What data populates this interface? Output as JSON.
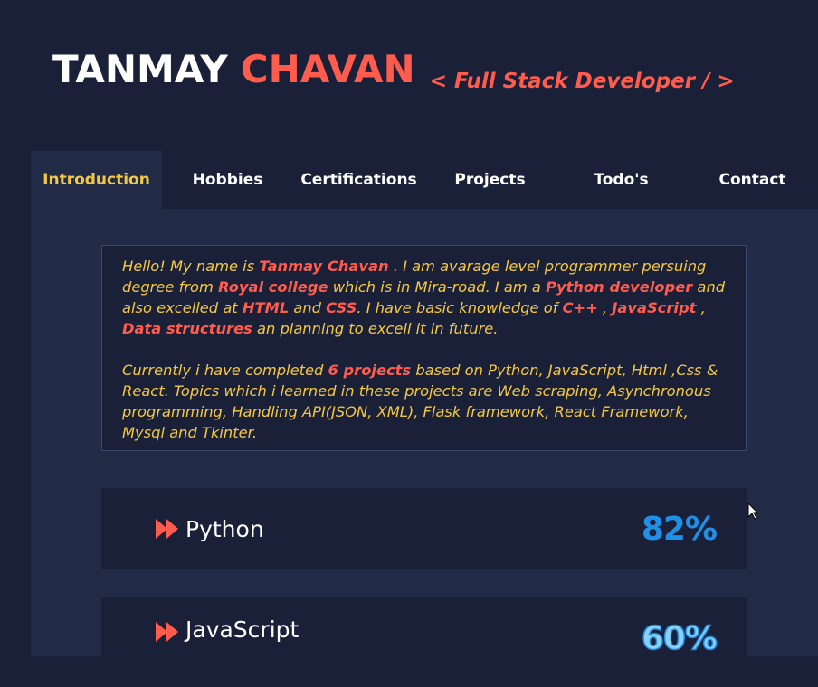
{
  "header": {
    "first_name": "TANMAY",
    "last_name": "CHAVAN",
    "role": "< Full Stack Developer / >"
  },
  "tabs": [
    {
      "label": "Introduction",
      "active": true
    },
    {
      "label": "Hobbies"
    },
    {
      "label": "Certifications"
    },
    {
      "label": "Projects"
    },
    {
      "label": "Todo's"
    },
    {
      "label": "Contact"
    }
  ],
  "intro": {
    "p1": [
      "Hello! My name is ",
      "Tanmay Chavan",
      " . I am avarage level programmer persuing degree from ",
      "Royal college",
      " which is in Mira-road. I am a ",
      "Python developer",
      " and also excelled at ",
      "HTML",
      " and ",
      "CSS",
      ". I have basic knowledge of ",
      "C++",
      " , ",
      "JavaScript",
      " , ",
      "Data structures",
      " an planning to excell it in future."
    ],
    "p2": [
      "Currently i have completed ",
      "6 projects",
      " based on Python, JavaScript, Html ,Css & React. Topics which i learned in these projects are Web scraping, Asynchronous programming, Handling API(JSON, XML), Flask framework, React Framework, Mysql and Tkinter."
    ]
  },
  "skills": [
    {
      "name": "Python",
      "percent": "82%"
    },
    {
      "name": "JavaScript",
      "percent": "60%"
    }
  ],
  "colors": {
    "background": "#1a2038",
    "panel": "#222b45",
    "accent_red": "#ff5c4d",
    "accent_yellow": "#f5c842",
    "accent_blue": "#1e90e8"
  },
  "icons": {
    "skill_bullet": "fast-forward-icon",
    "cursor": "mouse-pointer-icon"
  }
}
